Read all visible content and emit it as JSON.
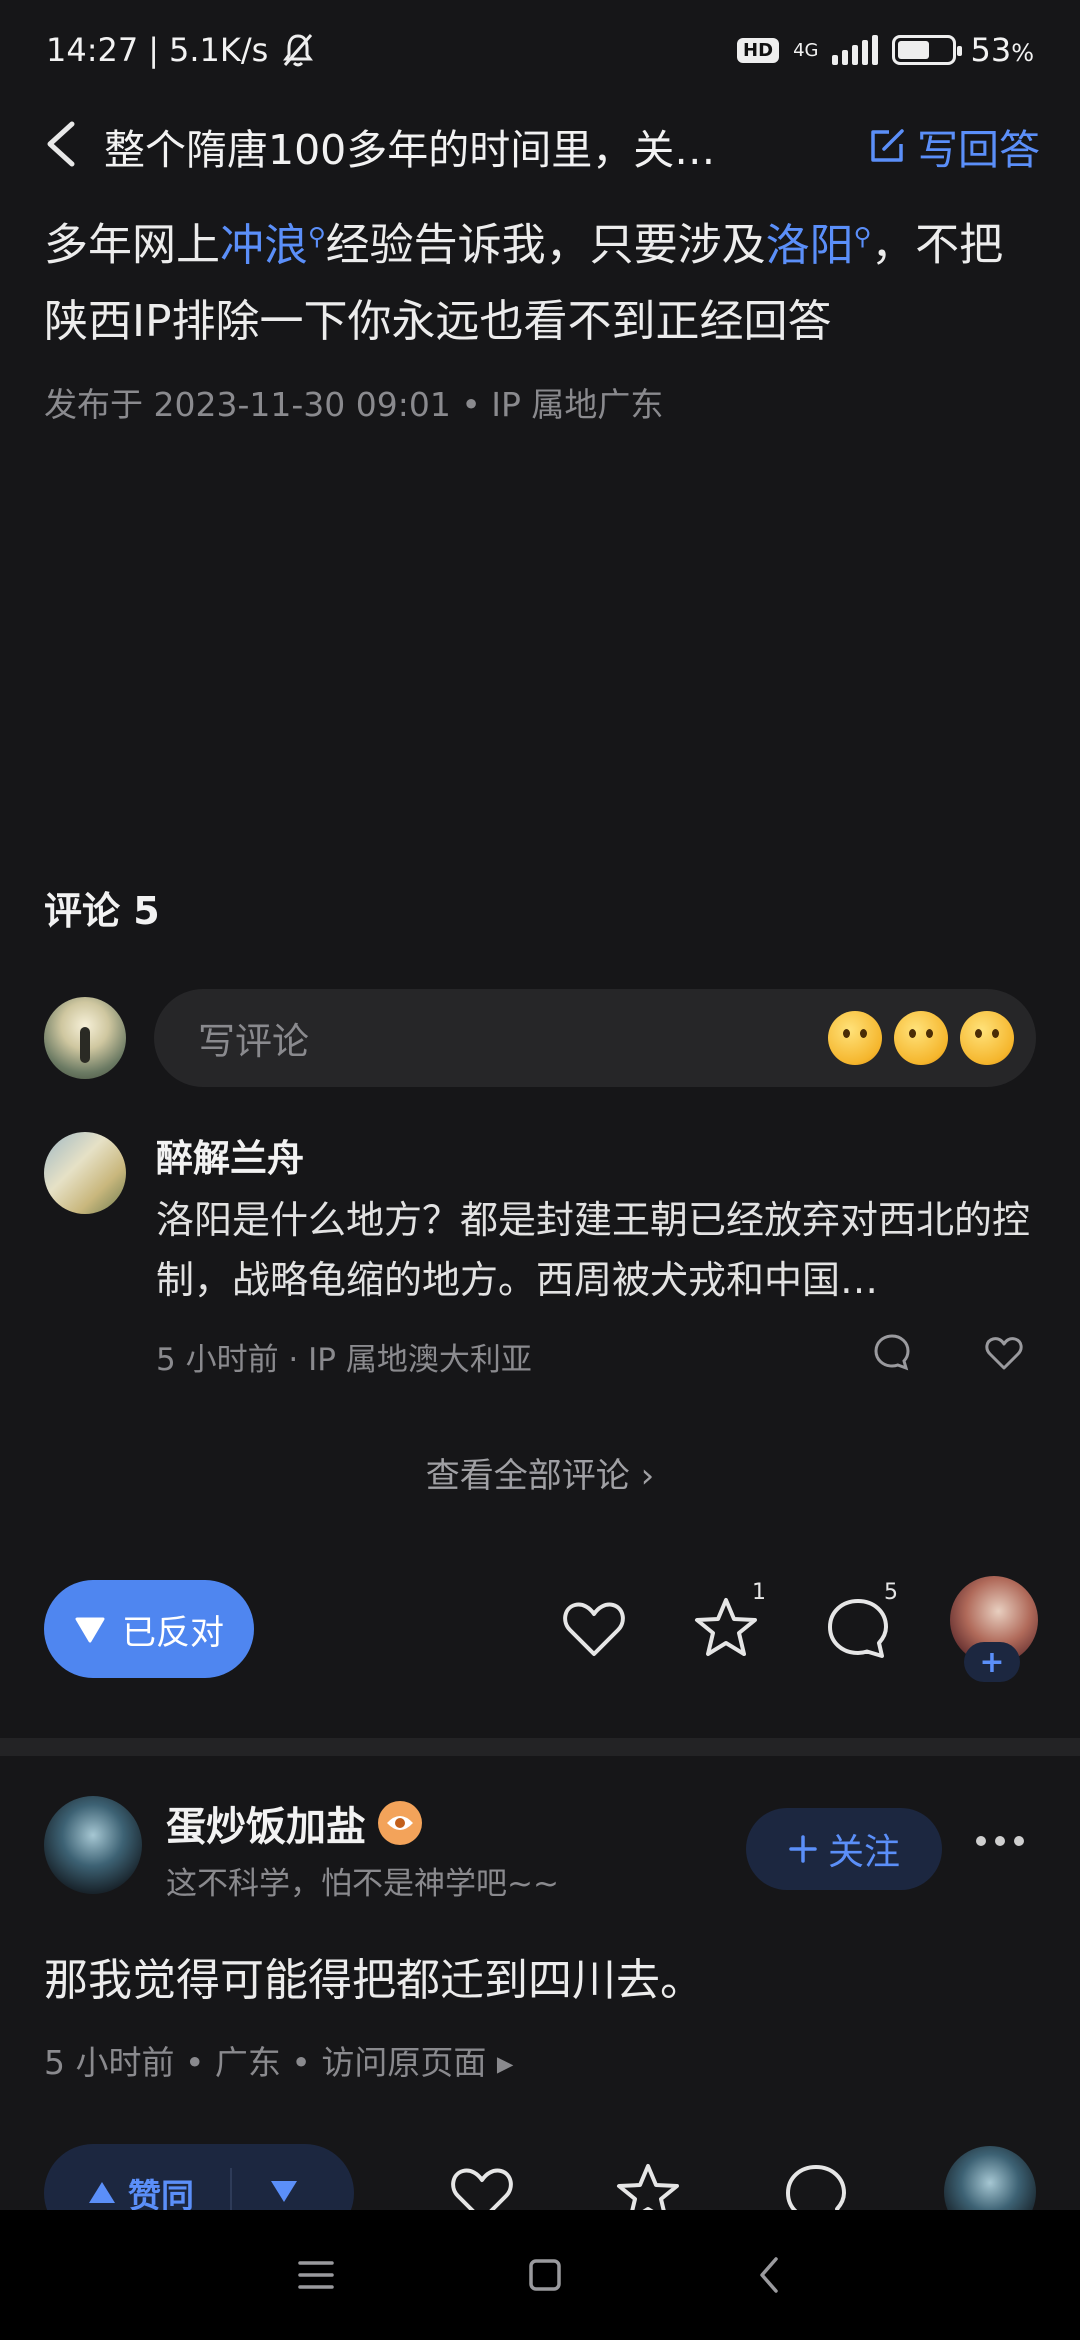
{
  "status_bar": {
    "time": "14:27",
    "speed": "5.1K/s",
    "hd": "HD",
    "network": "4G",
    "battery": "53",
    "battery_unit": "%",
    "battery_level": 0.53
  },
  "header": {
    "title": "整个隋唐100多年的时间里，关…",
    "write_answer": "写回答"
  },
  "answer": {
    "text_1": "多年网上",
    "kw_1": "冲浪",
    "text_2": "经验告诉我，只要涉及",
    "kw_2": "洛阳",
    "text_3": "，不把陕西IP排除一下你永远也看不到正经回答",
    "published": "发布于 2023-11-30 09:01 • IP 属地广东"
  },
  "comments": {
    "title": "评论 5",
    "input_placeholder": "写评论",
    "items": [
      {
        "name": "醉解兰舟",
        "body": "洛阳是什么地方？都是封建王朝已经放弃对西北的控制，战略龟缩的地方。西周被犬戎和中国…",
        "meta": "5 小时前 · IP 属地澳大利亚"
      }
    ],
    "view_all": "查看全部评论 ›"
  },
  "actions": {
    "oppose_label": "已反对",
    "star_count": "1",
    "comment_count": "5",
    "follow_plus": "+"
  },
  "answer2": {
    "author": "蛋炒饭加盐",
    "signature": "这不科学，怕不是神学吧~~",
    "follow_label": "关注",
    "text": "那我觉得可能得把都迁到四川去。",
    "meta": "5 小时前 • 广东 • 访问原页面 ▸",
    "upvote_label": "赞同"
  },
  "colors": {
    "accent": "#5b8ff9",
    "background": "#161618",
    "oppose": "#4f86f0"
  }
}
